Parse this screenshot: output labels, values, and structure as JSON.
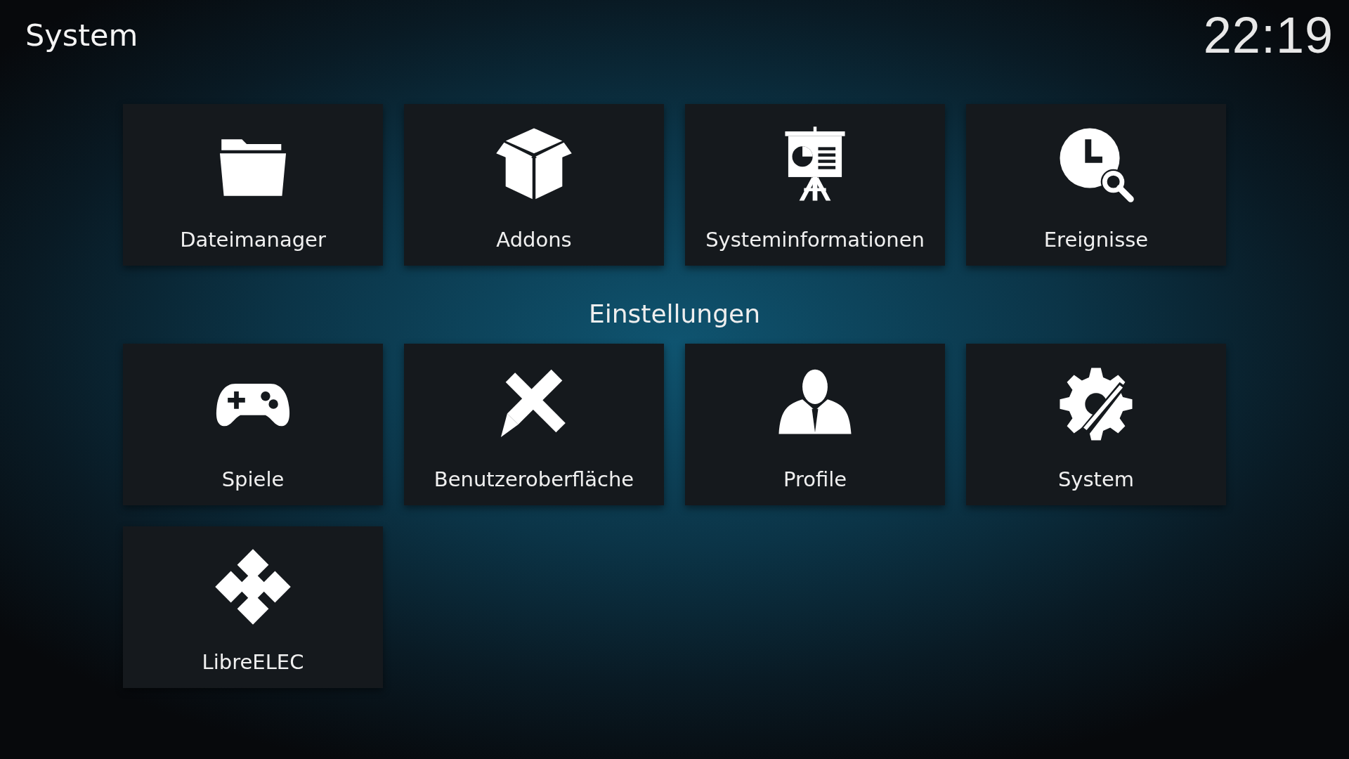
{
  "header": {
    "title": "System",
    "clock": "22:19"
  },
  "top_tiles": [
    {
      "label": "Dateimanager"
    },
    {
      "label": "Addons"
    },
    {
      "label": "Systeminformationen"
    },
    {
      "label": "Ereignisse"
    }
  ],
  "settings": {
    "title": "Einstellungen",
    "tiles": [
      {
        "label": "Spiele"
      },
      {
        "label": "Benutzeroberfläche"
      },
      {
        "label": "Profile"
      },
      {
        "label": "System"
      },
      {
        "label": "LibreELEC"
      }
    ]
  }
}
